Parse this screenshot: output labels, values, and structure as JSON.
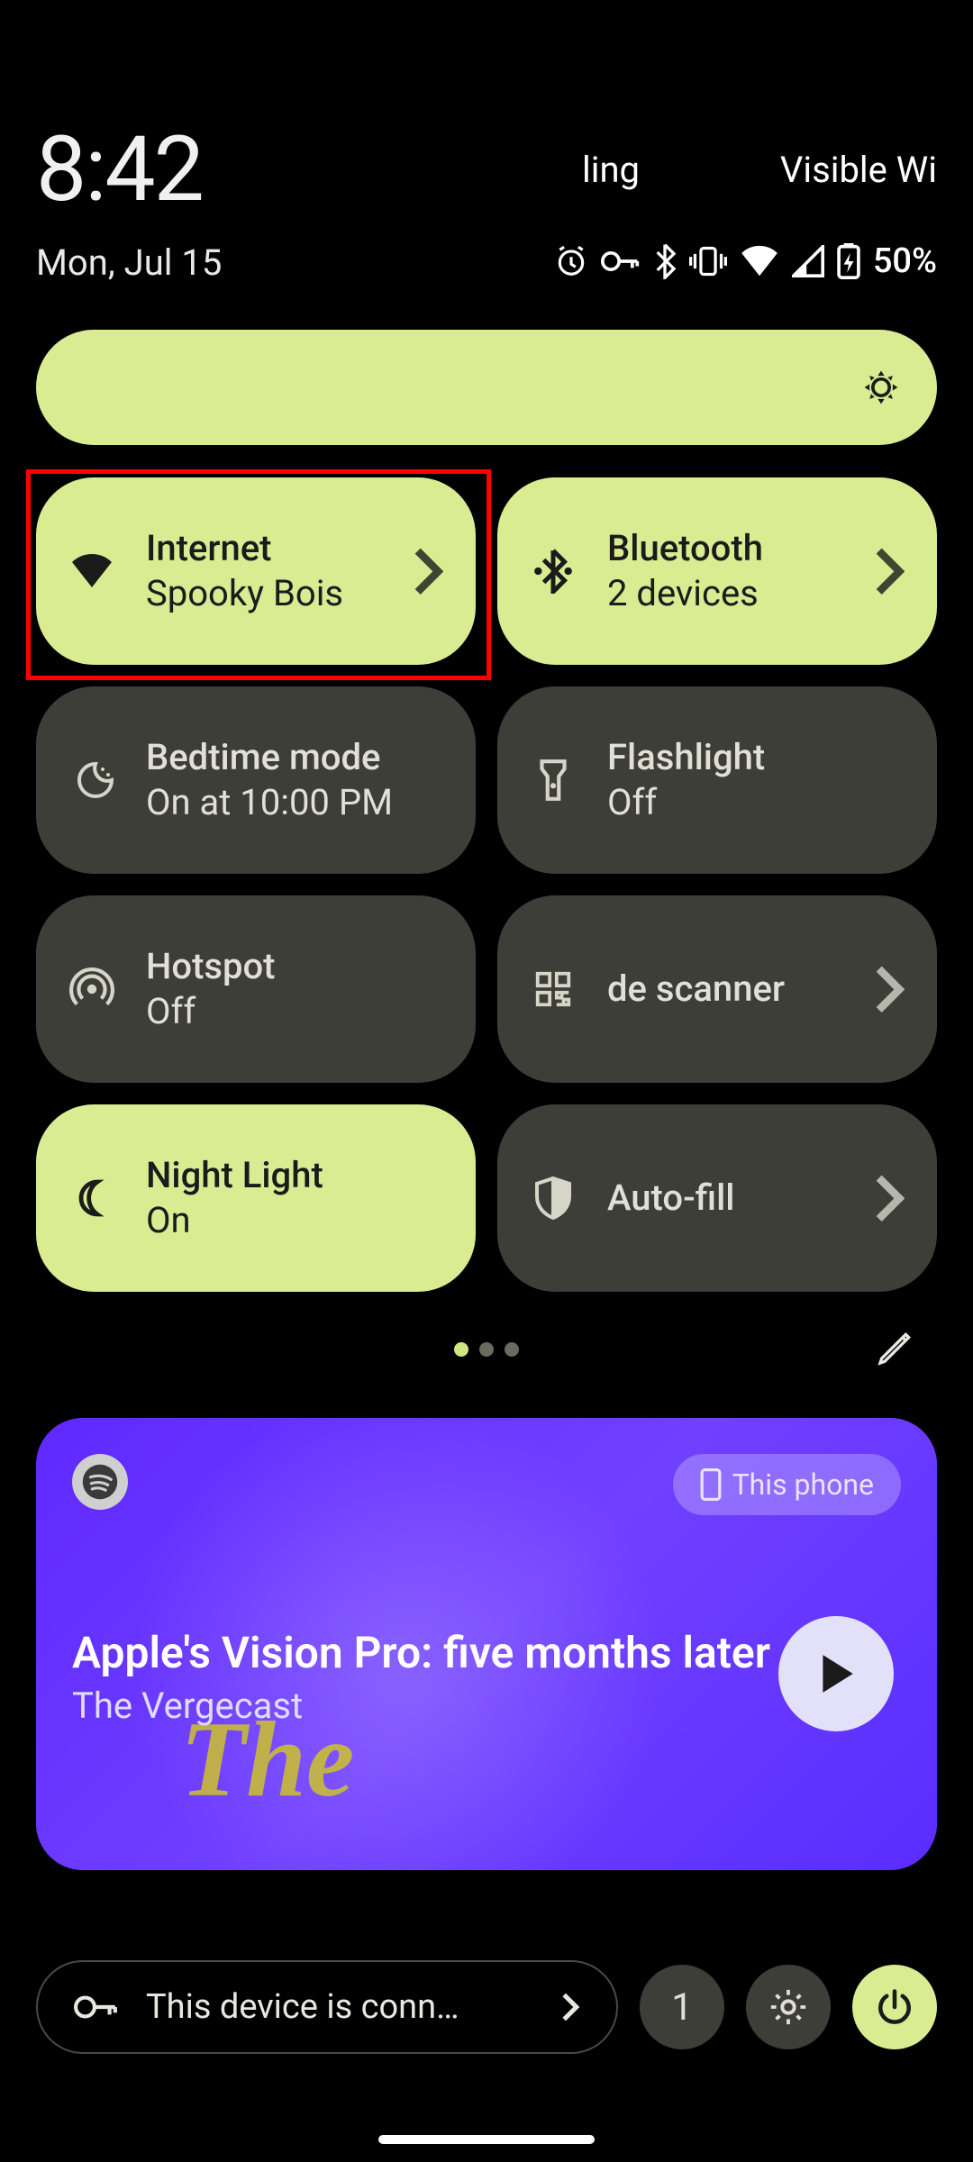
{
  "status_bar": {
    "time": "8:42",
    "date": "Mon, Jul 15",
    "carrier_fragment_left": "ling",
    "carrier_fragment_right": "Visible Wi",
    "battery_text": "50%",
    "icons": [
      "alarm",
      "vpn",
      "bluetooth",
      "vibrate",
      "wifi",
      "signal",
      "battery-charging"
    ]
  },
  "tiles": {
    "internet": {
      "title": "Internet",
      "sub": "Spooky Bois",
      "on": true,
      "chevron": true
    },
    "bluetooth": {
      "title": "Bluetooth",
      "sub": "2 devices",
      "on": true,
      "chevron": true
    },
    "bedtime": {
      "title": "Bedtime mode",
      "sub": "On at 10:00 PM",
      "on": false,
      "chevron": false
    },
    "flashlight": {
      "title": "Flashlight",
      "sub": "Off",
      "on": false,
      "chevron": false
    },
    "hotspot": {
      "title": "Hotspot",
      "sub": "Off",
      "on": false,
      "chevron": false
    },
    "qr": {
      "title": "de scanner",
      "sub": "",
      "on": false,
      "chevron": true
    },
    "nightlight": {
      "title": "Night Light",
      "sub": "On",
      "on": true,
      "chevron": false
    },
    "autofill": {
      "title": "Auto-fill",
      "sub": "",
      "on": false,
      "chevron": true
    }
  },
  "pager": {
    "pages": 3,
    "active": 0
  },
  "media": {
    "source_app": "Spotify",
    "cast_target": "This phone",
    "title": "Apple's Vision Pro: five months later",
    "subtitle": "The Vergecast",
    "accent_text": "The"
  },
  "footer": {
    "vpn_text": "This device is conn…",
    "user_count": "1"
  },
  "colors": {
    "accent": "#d9ec92",
    "tile_off": "#3e3e38"
  }
}
